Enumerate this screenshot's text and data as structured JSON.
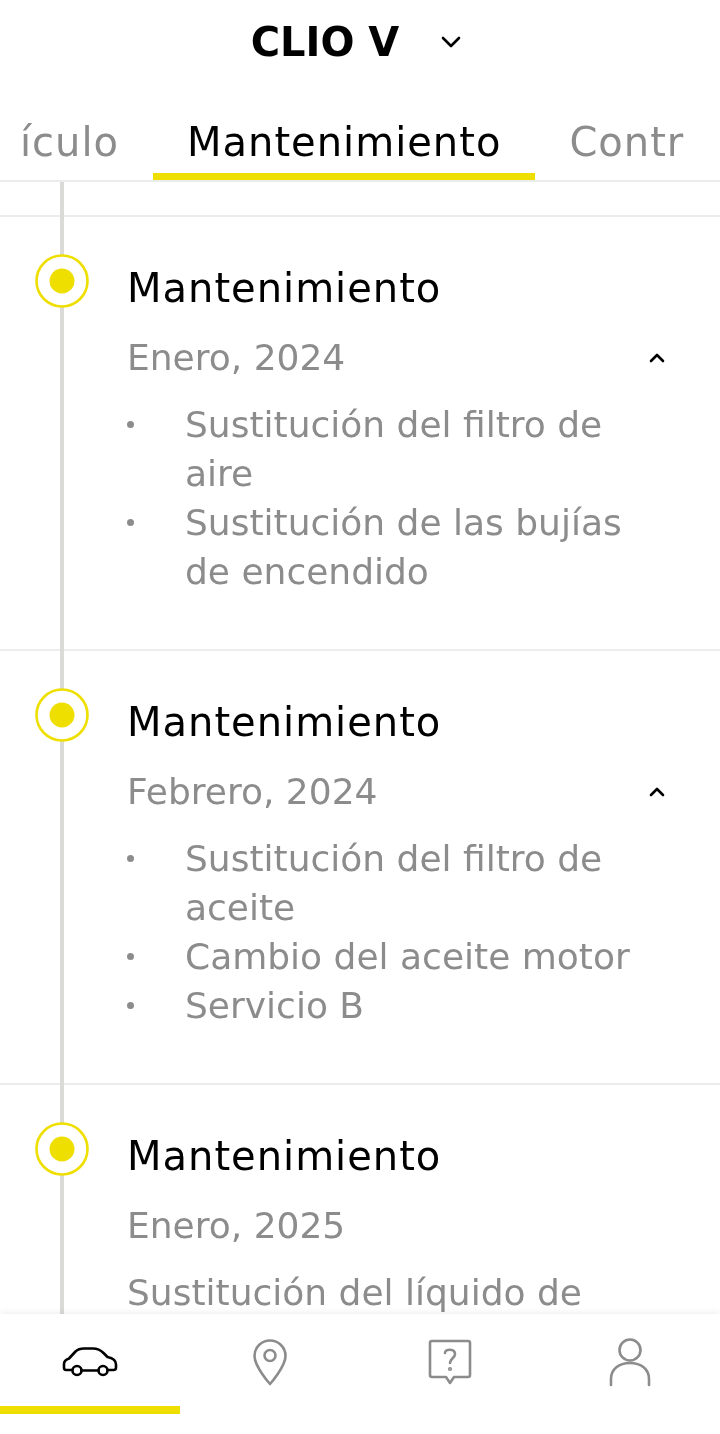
{
  "header": {
    "title": "CLIO V"
  },
  "tabs": [
    {
      "label": "ículo",
      "selected": false
    },
    {
      "label": "Mantenimiento",
      "selected": true
    },
    {
      "label": "Contr",
      "selected": false
    }
  ],
  "timeline": [
    {
      "kind": "list",
      "title": "Mantenimiento",
      "date": "Enero, 2024",
      "expanded": true,
      "items": [
        "Sustitución del filtro de aire",
        "Sustitución de las bujías de encendido"
      ]
    },
    {
      "kind": "list",
      "title": "Mantenimiento",
      "date": "Febrero, 2024",
      "expanded": true,
      "items": [
        "Sustitución del filtro de aceite",
        "Cambio del aceite motor",
        "Servicio B"
      ]
    },
    {
      "kind": "text",
      "title": "Mantenimiento",
      "date": "Enero, 2025",
      "description": "Sustitución del líquido de"
    }
  ],
  "bottom_nav": [
    {
      "selected": true
    },
    {
      "selected": false
    },
    {
      "selected": false
    },
    {
      "selected": false
    }
  ]
}
